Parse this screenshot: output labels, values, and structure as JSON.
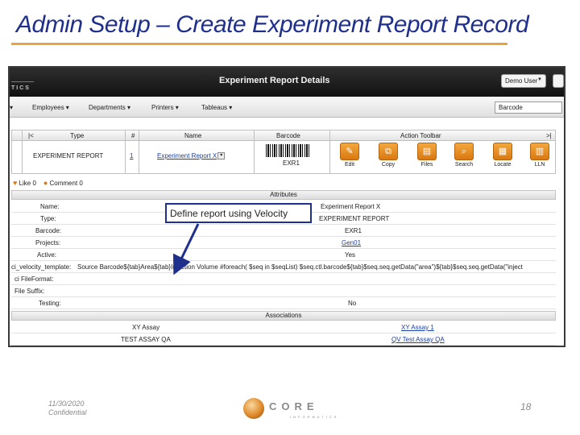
{
  "slide": {
    "title": "Admin Setup – Create Experiment Report Record",
    "date": "11/30/2020",
    "confidential": "Confidential",
    "page_number": "18",
    "logo_word": "CORE",
    "logo_sub": "INFORMATICS",
    "accent_color": "#e8a33d",
    "title_color": "#1f2f8c"
  },
  "app": {
    "logo_text": "TICS",
    "title": "Experiment Report Details",
    "user_button": "Demo User",
    "nav": [
      "Employees",
      "Departments",
      "Printers",
      "Tableaus"
    ],
    "nav_search": "Barcode"
  },
  "record_table": {
    "headers": [
      "|<",
      "Type",
      "#",
      "Name",
      "Barcode",
      "Action Toolbar",
      ">|"
    ],
    "type": "EXPERIMENT REPORT",
    "number": "1",
    "name": "Experiment Report X",
    "barcode": "EXR1",
    "toolbar": [
      {
        "label": "Edit",
        "icon": "pencil-icon"
      },
      {
        "label": "Copy",
        "icon": "copy-icon"
      },
      {
        "label": "Files",
        "icon": "files-icon"
      },
      {
        "label": "Search",
        "icon": "search-icon"
      },
      {
        "label": "Locate",
        "icon": "locate-icon"
      },
      {
        "label": "LLN",
        "icon": "book-icon"
      }
    ]
  },
  "likes": {
    "likes_label": "Like 0",
    "comments_label": "Comment 0"
  },
  "attributes": {
    "header": "Attributes",
    "rows": [
      {
        "label": "Name:",
        "value": "Experiment Report X"
      },
      {
        "label": "Type:",
        "value": "EXPERIMENT REPORT"
      },
      {
        "label": "Barcode:",
        "value": "EXR1"
      },
      {
        "label": "Projects:",
        "value": "Gen01"
      },
      {
        "label": "Active:",
        "value": "Yes"
      },
      {
        "label": "ci_velocity_template:",
        "value": "Source Barcode${tab}Area${tab}Injection Volume #foreach( $seq in $seqList) $seq.ctl.barcode${tab}$seq.seq.getData(\"area\")${tab}$seq.seq.getData(\"inject"
      },
      {
        "label": "ci FileFormat:",
        "value": ""
      },
      {
        "label": "File Suffix:",
        "value": ""
      },
      {
        "label": "Testing:",
        "value": "No"
      }
    ]
  },
  "associations": {
    "header": "Associations",
    "rows": [
      {
        "left": "XY Assay",
        "right": "XY Assay 1"
      },
      {
        "left": "TEST ASSAY QA",
        "right": "QV Test Assay QA"
      }
    ]
  },
  "callout": "Define report using Velocity"
}
